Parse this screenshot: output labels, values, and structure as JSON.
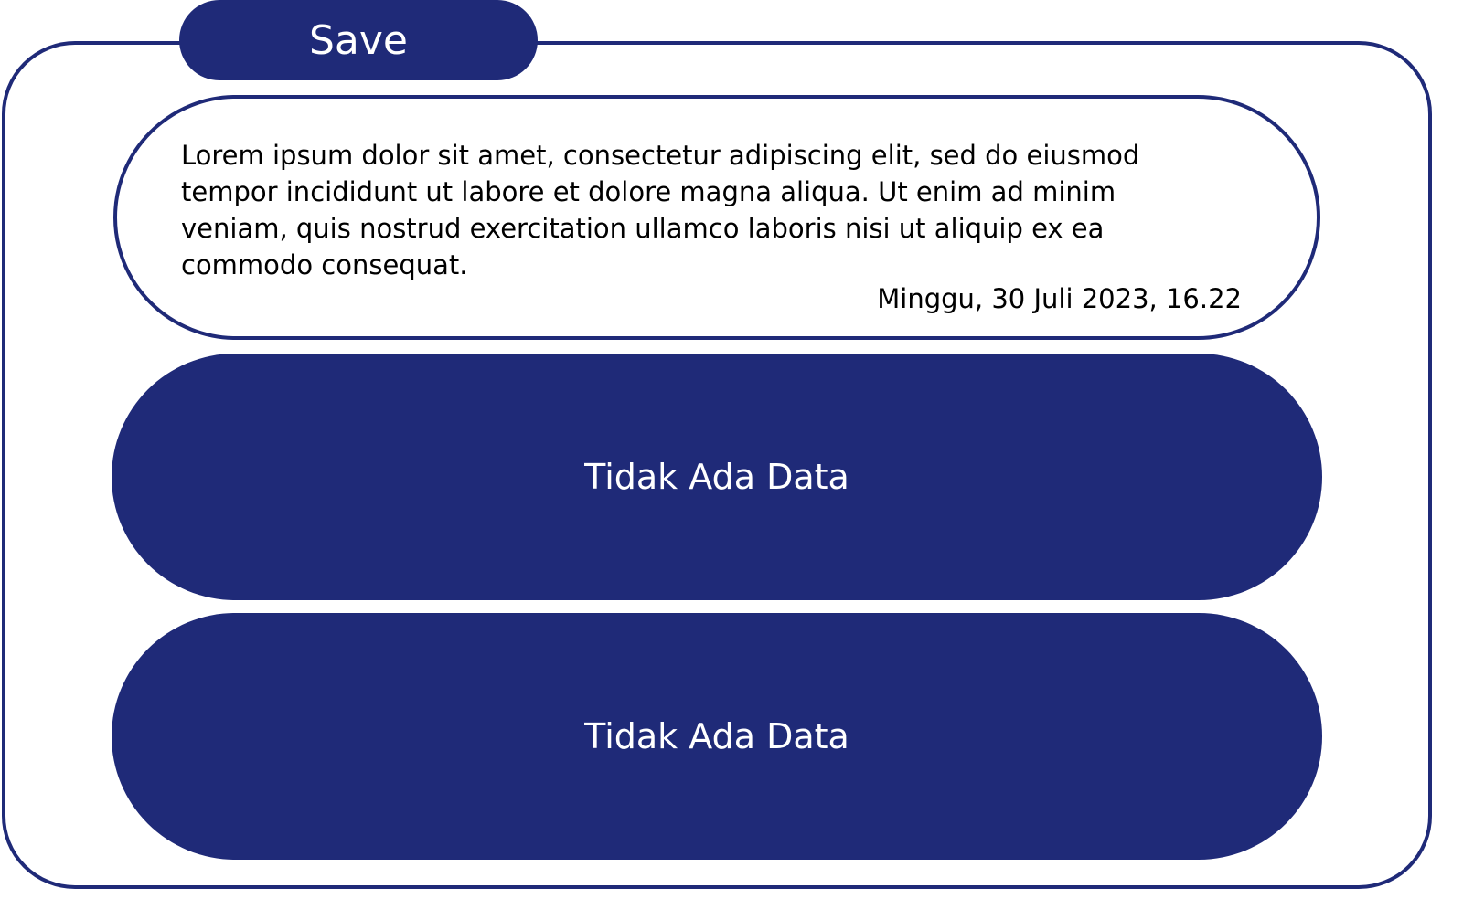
{
  "colors": {
    "primary": "#1f2a78"
  },
  "save_button": {
    "label": "Save"
  },
  "note": {
    "text": "Lorem ipsum dolor sit amet, consectetur adipiscing elit, sed do eiusmod tempor incididunt ut labore et dolore magna aliqua. Ut enim ad minim veniam, quis nostrud exercitation ullamco laboris nisi ut aliquip ex ea commodo consequat.",
    "date": "Minggu, 30 Juli 2023, 16.22"
  },
  "panels": [
    {
      "label": "Tidak Ada Data"
    },
    {
      "label": "Tidak Ada Data"
    }
  ]
}
